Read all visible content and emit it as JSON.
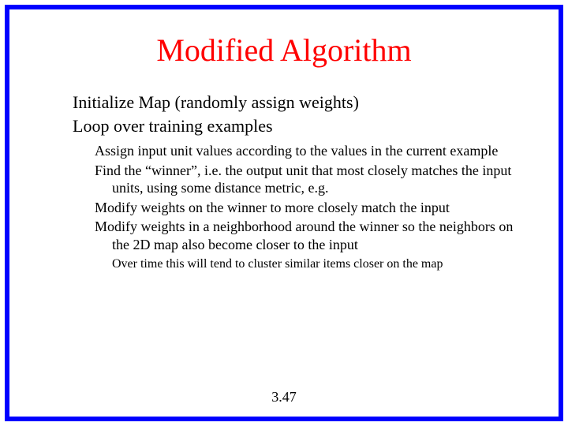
{
  "title": "Modified Algorithm",
  "level1": {
    "line1": "Initialize Map (randomly assign weights)",
    "line2": "Loop over training examples"
  },
  "level2": {
    "p1": "Assign input unit values according to the values in the current example",
    "p2": "Find the “winner”, i.e. the output unit that most closely matches the input units, using some distance metric, e.g.",
    "p3": "Modify weights on the winner to more closely match the input",
    "p4": "Modify weights in a neighborhood around the winner so the neighbors on the 2D map also become closer to the input"
  },
  "level3": {
    "p1": "Over time this will tend to cluster similar items closer on the map"
  },
  "pagenum": "3.47"
}
